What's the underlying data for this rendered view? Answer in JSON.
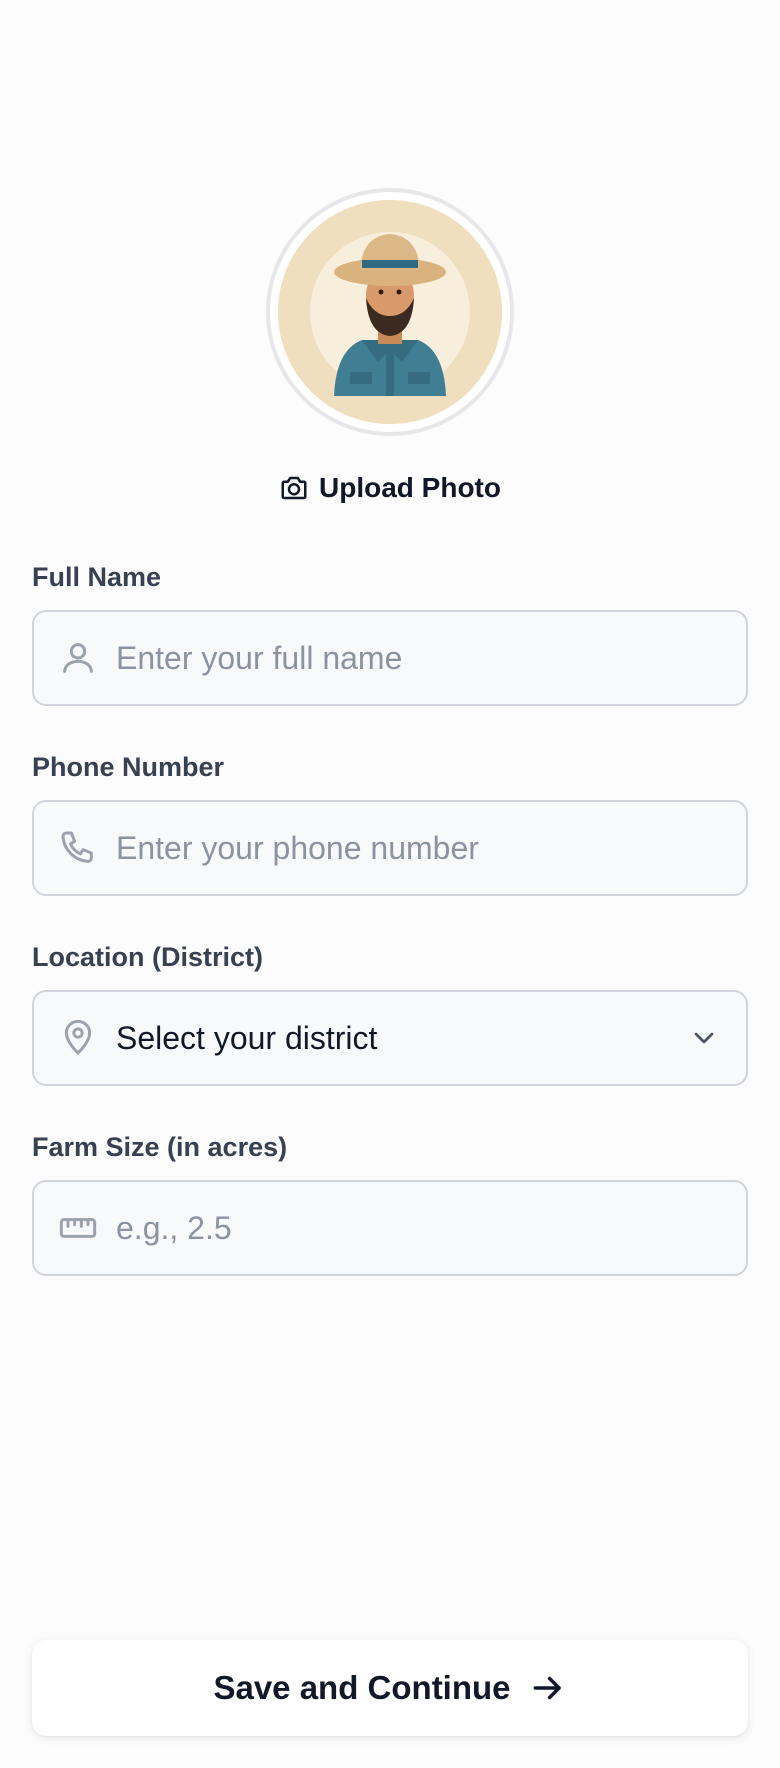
{
  "profile": {
    "avatar_icon": "farmer-avatar-illustration",
    "upload_label": "Upload Photo",
    "upload_icon": "camera-icon"
  },
  "form": {
    "full_name": {
      "label": "Full Name",
      "placeholder": "Enter your full name",
      "value": "",
      "icon": "user-icon"
    },
    "phone": {
      "label": "Phone Number",
      "placeholder": "Enter your phone number",
      "value": "",
      "icon": "phone-icon"
    },
    "location": {
      "label": "Location (District)",
      "selected": "Select your district",
      "icon": "map-pin-icon",
      "dropdown_icon": "chevron-down-icon"
    },
    "farm_size": {
      "label": "Farm Size (in acres)",
      "placeholder": "e.g., 2.5",
      "value": "",
      "icon": "ruler-icon"
    }
  },
  "actions": {
    "save_label": "Save and Continue",
    "save_icon": "arrow-right-icon"
  },
  "colors": {
    "input_background": "#f8f9fb",
    "input_border": "#d1d5db",
    "label_text": "#374151",
    "placeholder_text": "#8b93a1",
    "icon_gray": "#9ca3af",
    "avatar_background": "#efdfbf"
  }
}
